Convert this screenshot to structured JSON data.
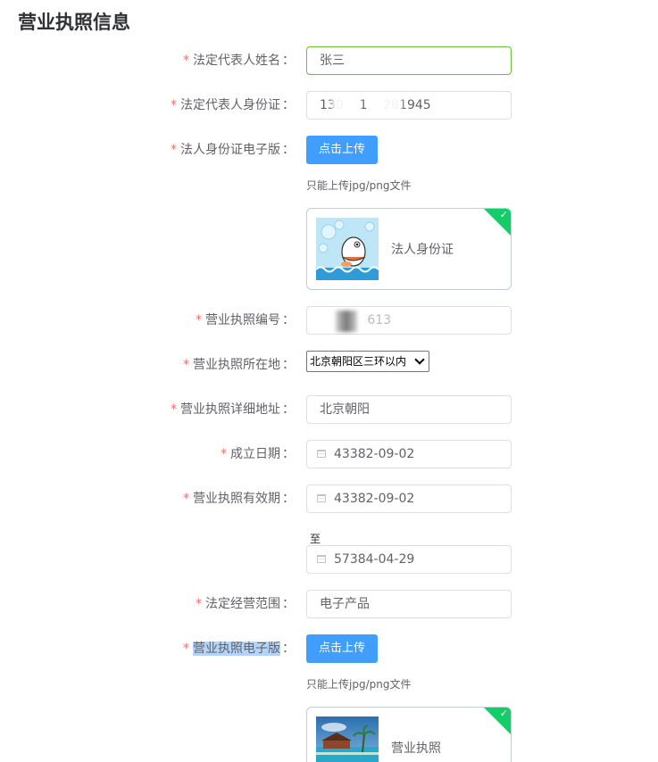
{
  "page_title": "营业执照信息",
  "fields": {
    "legal_rep_name": {
      "label": "法定代表人姓名",
      "value": "张三"
    },
    "legal_rep_id": {
      "label": "法定代表人身份证",
      "value": "130    1    281945"
    },
    "legal_id_scan": {
      "label": "法人身份证电子版",
      "button": "点击上传",
      "hint": "只能上传jpg/png文件",
      "file_name": "法人身份证"
    },
    "license_number": {
      "label": "营业执照编号",
      "value": "     56   613"
    },
    "license_location": {
      "label": "营业执照所在地",
      "selected": "北京朝阳区三环以内"
    },
    "license_address": {
      "label": "营业执照详细地址",
      "value": "北京朝阳"
    },
    "established_date": {
      "label": "成立日期",
      "value": "43382-09-02"
    },
    "validity": {
      "label": "营业执照有效期",
      "start": "43382-09-02",
      "separator": "至",
      "end": "57384-04-29"
    },
    "business_scope": {
      "label": "法定经营范围",
      "value": "电子产品"
    },
    "license_scan": {
      "label": "营业执照电子版",
      "button": "点击上传",
      "hint": "只能上传jpg/png文件",
      "file_name": "营业执照"
    }
  },
  "required_mark": "*",
  "colon": "：",
  "colors": {
    "primary": "#409eff",
    "required": "#f56c6c",
    "success": "#13ce66",
    "focus_border": "#67c23a"
  }
}
